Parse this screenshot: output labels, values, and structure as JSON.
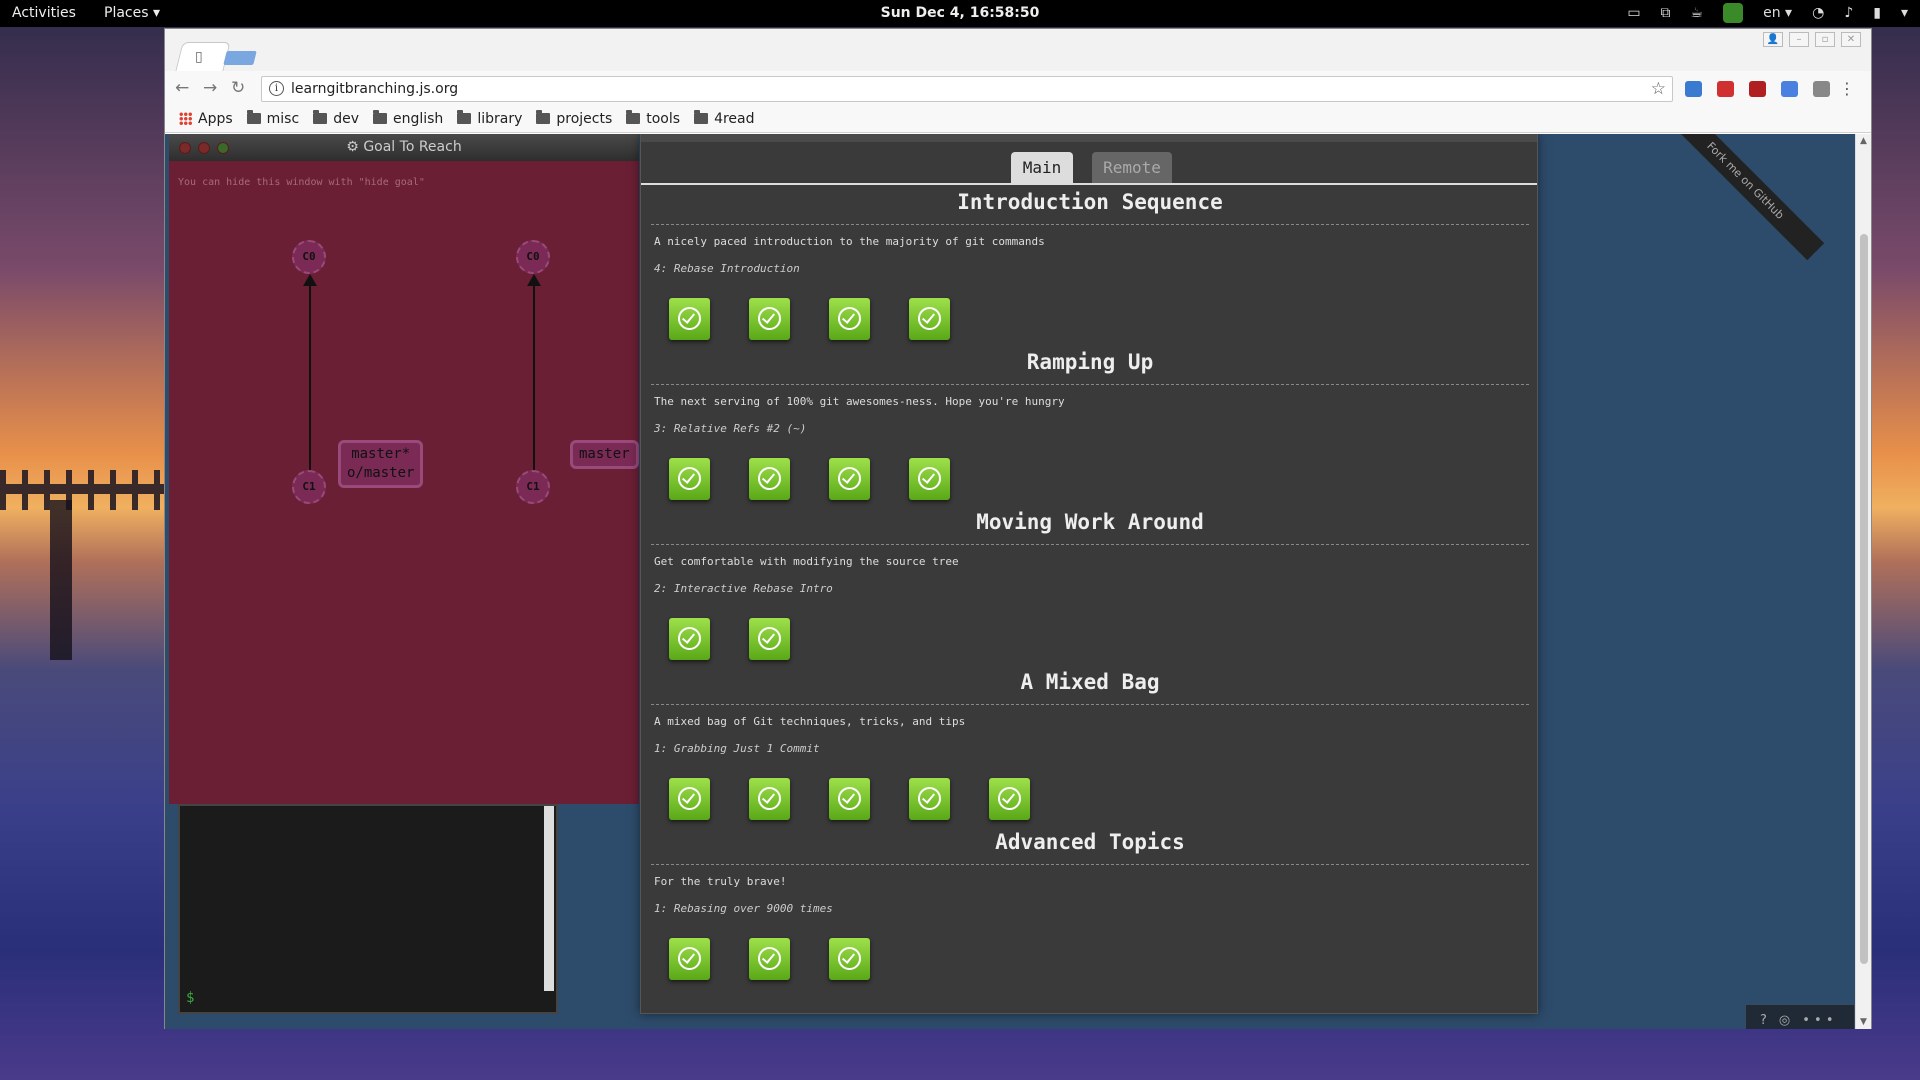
{
  "desktop": {
    "activities": "Activities",
    "places": "Places",
    "clock": "Sun Dec  4, 16:58:50",
    "lang": "en"
  },
  "browser": {
    "url": "learngitbranching.js.org",
    "bookmarks": {
      "apps": "Apps",
      "folders": [
        "misc",
        "dev",
        "english",
        "library",
        "projects",
        "tools",
        "4read"
      ]
    }
  },
  "goal": {
    "title": "Goal To Reach",
    "hint": "You can hide this window with \"hide goal\"",
    "left": {
      "c0": "C0",
      "c1": "C1",
      "branch_line1": "master*",
      "branch_line2": "o/master"
    },
    "right": {
      "c0": "C0",
      "c1": "C1",
      "branch": "master"
    }
  },
  "terminal": {
    "prompt": "$"
  },
  "panel": {
    "tabs": {
      "main": "Main",
      "remote": "Remote"
    },
    "sections": [
      {
        "title": "Introduction Sequence",
        "desc": "A nicely paced introduction to the majority of git commands",
        "level": "4: Rebase Introduction",
        "count": 4
      },
      {
        "title": "Ramping Up",
        "desc": "The next serving of 100% git awesomes-ness. Hope you're hungry",
        "level": "3: Relative Refs #2 (~)",
        "count": 4
      },
      {
        "title": "Moving Work Around",
        "desc": "Get comfortable with modifying the source tree",
        "level": "2: Interactive Rebase Intro",
        "count": 2
      },
      {
        "title": "A Mixed Bag",
        "desc": "A mixed bag of Git techniques, tricks, and tips",
        "level": "1: Grabbing Just 1 Commit",
        "count": 5
      },
      {
        "title": "Advanced Topics",
        "desc": "For the truly brave!",
        "level": "1: Rebasing over 9000 times",
        "count": 3
      }
    ]
  },
  "ribbon": "Fork me on GitHub",
  "helper": {
    "help": "?",
    "globe": "◎"
  }
}
